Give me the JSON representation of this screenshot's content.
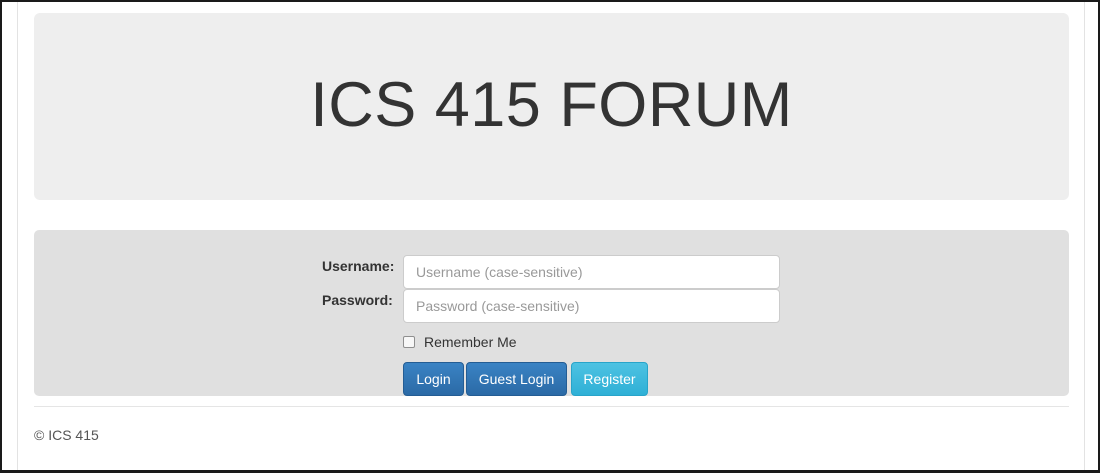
{
  "header": {
    "title": "ICS 415 FORUM"
  },
  "login_form": {
    "username_label": "Username:",
    "username_placeholder": "Username (case-sensitive)",
    "username_value": "",
    "password_label": "Password:",
    "password_placeholder": "Password (case-sensitive)",
    "password_value": "",
    "remember_me_label": "Remember Me",
    "remember_me_checked": false,
    "login_button": "Login",
    "guest_login_button": "Guest Login",
    "register_button": "Register"
  },
  "footer": {
    "copyright": "© ICS 415"
  },
  "colors": {
    "primary": "#337ab7",
    "info": "#39b3d7",
    "jumbotron_bg": "#eeeeee",
    "well_bg": "#e0e0e0"
  }
}
